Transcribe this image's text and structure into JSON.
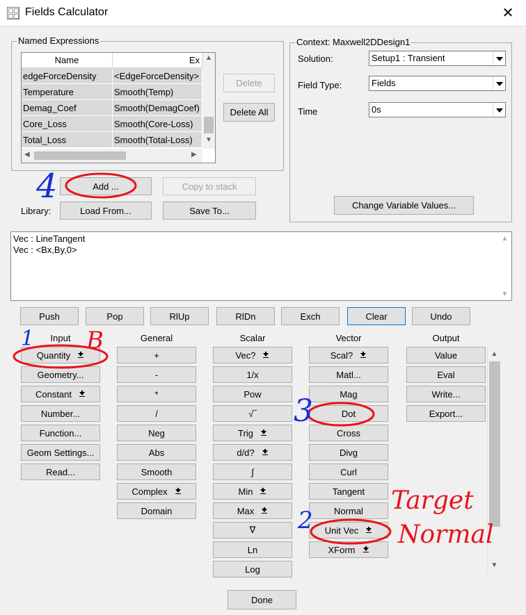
{
  "window": {
    "title": "Fields Calculator",
    "close_glyph": "✕"
  },
  "named_expressions": {
    "group_title": "Named Expressions",
    "columns": [
      "Name",
      "Ex"
    ],
    "rows": [
      {
        "name": "edgeForceDensity",
        "expr": "<EdgeForceDensity>"
      },
      {
        "name": "Temperature",
        "expr": "Smooth(Temp)"
      },
      {
        "name": "Demag_Coef",
        "expr": "Smooth(DemagCoef)"
      },
      {
        "name": "Core_Loss",
        "expr": "Smooth(Core-Loss)"
      },
      {
        "name": "Total_Loss",
        "expr": "Smooth(Total-Loss)"
      }
    ],
    "delete_label": "Delete",
    "delete_all_label": "Delete All",
    "add_label": "Add ...",
    "copy_to_stack_label": "Copy to stack",
    "library_label": "Library:",
    "load_from_label": "Load From...",
    "save_to_label": "Save To..."
  },
  "context": {
    "group_title": "Context: Maxwell2DDesign1",
    "solution_label": "Solution:",
    "solution_value": "Setup1 : Transient",
    "field_type_label": "Field Type:",
    "field_type_value": "Fields",
    "time_label": "Time",
    "time_value": "0s",
    "change_vars_label": "Change Variable Values..."
  },
  "stack": {
    "lines": [
      "Vec : LineTangent",
      "Vec : <Bx,By,0>"
    ]
  },
  "stack_buttons": [
    "Push",
    "Pop",
    "RlUp",
    "RlDn",
    "Exch",
    "Clear",
    "Undo"
  ],
  "columns": {
    "input": {
      "header": "Input",
      "buttons": [
        {
          "label": "Quantity",
          "dropdown": true
        },
        {
          "label": "Geometry...",
          "dropdown": false
        },
        {
          "label": "Constant",
          "dropdown": true
        },
        {
          "label": "Number...",
          "dropdown": false
        },
        {
          "label": "Function...",
          "dropdown": false
        },
        {
          "label": "Geom Settings...",
          "dropdown": false
        },
        {
          "label": "Read...",
          "dropdown": false
        }
      ]
    },
    "general": {
      "header": "General",
      "buttons": [
        {
          "label": "+",
          "dropdown": false
        },
        {
          "label": "-",
          "dropdown": false
        },
        {
          "label": "*",
          "dropdown": false
        },
        {
          "label": "/",
          "dropdown": false
        },
        {
          "label": "Neg",
          "dropdown": false
        },
        {
          "label": "Abs",
          "dropdown": false
        },
        {
          "label": "Smooth",
          "dropdown": false
        },
        {
          "label": "Complex",
          "dropdown": true
        },
        {
          "label": "Domain",
          "dropdown": false
        }
      ]
    },
    "scalar": {
      "header": "Scalar",
      "buttons": [
        {
          "label": "Vec?",
          "dropdown": true
        },
        {
          "label": "1/x",
          "dropdown": false
        },
        {
          "label": "Pow",
          "dropdown": false
        },
        {
          "label": "√‾",
          "dropdown": false
        },
        {
          "label": "Trig",
          "dropdown": true
        },
        {
          "label": "d/d?",
          "dropdown": true
        },
        {
          "label": "∫",
          "dropdown": false
        },
        {
          "label": "Min",
          "dropdown": true
        },
        {
          "label": "Max",
          "dropdown": true
        },
        {
          "label": "∇",
          "dropdown": false
        },
        {
          "label": "Ln",
          "dropdown": false
        },
        {
          "label": "Log",
          "dropdown": false
        }
      ]
    },
    "vector": {
      "header": "Vector",
      "buttons": [
        {
          "label": "Scal?",
          "dropdown": true
        },
        {
          "label": "Matl...",
          "dropdown": false
        },
        {
          "label": "Mag",
          "dropdown": false
        },
        {
          "label": "Dot",
          "dropdown": false
        },
        {
          "label": "Cross",
          "dropdown": false
        },
        {
          "label": "Divg",
          "dropdown": false
        },
        {
          "label": "Curl",
          "dropdown": false
        },
        {
          "label": "Tangent",
          "dropdown": false
        },
        {
          "label": "Normal",
          "dropdown": false
        },
        {
          "label": "Unit Vec",
          "dropdown": true
        },
        {
          "label": "XForm",
          "dropdown": true
        }
      ]
    },
    "output": {
      "header": "Output",
      "buttons": [
        {
          "label": "Value",
          "dropdown": false
        },
        {
          "label": "Eval",
          "dropdown": false
        },
        {
          "label": "Write...",
          "dropdown": false
        },
        {
          "label": "Export...",
          "dropdown": false
        }
      ]
    }
  },
  "done_label": "Done",
  "annotations": {
    "color": "#e8141c",
    "blue": "#1a2fd6",
    "num1": "1",
    "num2": "2",
    "num3": "3",
    "num4": "4",
    "letter_b": "B",
    "target_text_1": "Target",
    "target_text_2": "Normal"
  }
}
